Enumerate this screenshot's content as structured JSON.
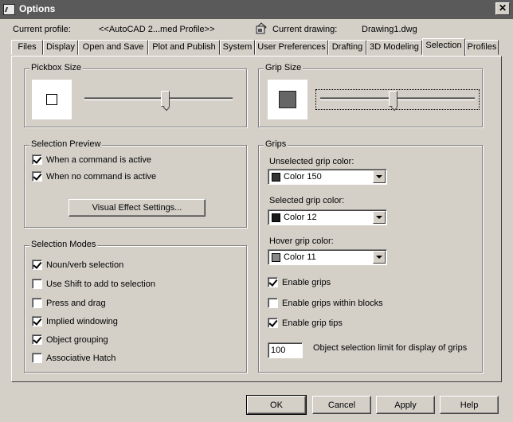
{
  "window": {
    "title": "Options"
  },
  "header": {
    "profile_label": "Current profile:",
    "profile_value": "<<AutoCAD 2...med Profile>>",
    "drawing_label": "Current drawing:",
    "drawing_value": "Drawing1.dwg"
  },
  "tabs": [
    {
      "label": "Files"
    },
    {
      "label": "Display"
    },
    {
      "label": "Open and Save"
    },
    {
      "label": "Plot and Publish"
    },
    {
      "label": "System"
    },
    {
      "label": "User Preferences"
    },
    {
      "label": "Drafting"
    },
    {
      "label": "3D Modeling"
    },
    {
      "label": "Selection"
    },
    {
      "label": "Profiles"
    }
  ],
  "active_tab": "Selection",
  "pickbox": {
    "legend": "Pickbox Size",
    "level": 0.55
  },
  "gripsize": {
    "legend": "Grip Size",
    "level": 0.47
  },
  "selection_preview": {
    "legend": "Selection Preview",
    "options": [
      {
        "label": "When a command is active",
        "checked": true
      },
      {
        "label": "When no command is active",
        "checked": true
      }
    ],
    "button": "Visual Effect Settings..."
  },
  "selection_modes": {
    "legend": "Selection Modes",
    "options": [
      {
        "label": "Noun/verb selection",
        "checked": true
      },
      {
        "label": "Use Shift to add to selection",
        "checked": false
      },
      {
        "label": "Press and drag",
        "checked": false
      },
      {
        "label": "Implied windowing",
        "checked": true
      },
      {
        "label": "Object grouping",
        "checked": true
      },
      {
        "label": "Associative Hatch",
        "checked": false
      }
    ]
  },
  "grips": {
    "legend": "Grips",
    "unselected_label": "Unselected grip color:",
    "unselected_value": "Color 150",
    "unselected_swatch": "#333333",
    "selected_label": "Selected grip color:",
    "selected_value": "Color 12",
    "selected_swatch": "#1a1a1a",
    "hover_label": "Hover grip color:",
    "hover_value": "Color 11",
    "hover_swatch": "#888888",
    "options": [
      {
        "label": "Enable grips",
        "checked": true
      },
      {
        "label": "Enable grips within blocks",
        "checked": false
      },
      {
        "label": "Enable grip tips",
        "checked": true
      }
    ],
    "limit_value": "100",
    "limit_label": "Object selection limit for display of grips"
  },
  "footer": {
    "ok": "OK",
    "cancel": "Cancel",
    "apply": "Apply",
    "help": "Help"
  }
}
